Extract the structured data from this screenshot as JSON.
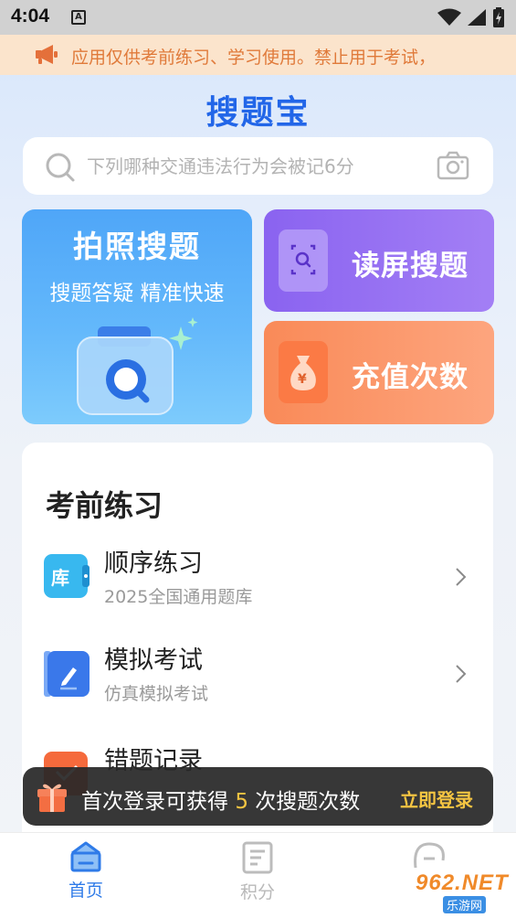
{
  "status_bar": {
    "time": "4:04",
    "a_badge": "A"
  },
  "notice": {
    "text": "应用仅供考前练习、学习使用。禁止用于考试，"
  },
  "app_title": "搜题宝",
  "search": {
    "placeholder": "下列哪种交通违法行为会被记6分"
  },
  "cards": {
    "photo_search": {
      "title": "拍照搜题",
      "subtitle": "搜题答疑 精准快速"
    },
    "screen_search": {
      "label": "读屏搜题"
    },
    "recharge": {
      "label": "充值次数",
      "icon_text": "¥"
    }
  },
  "practice": {
    "title": "考前练习",
    "items": [
      {
        "title": "顺序练习",
        "subtitle": "2025全国通用题库",
        "icon_text": "库"
      },
      {
        "title": "模拟考试",
        "subtitle": "仿真模拟考试"
      },
      {
        "title": "错题记录",
        "subtitle": ""
      }
    ]
  },
  "login_toast": {
    "text_before": "首次登录可获得 ",
    "count": "5",
    "text_after": " 次搜题次数",
    "button": "立即登录"
  },
  "bottom_nav": {
    "items": [
      {
        "label": "首页",
        "active": true
      },
      {
        "label": "积分",
        "active": false
      }
    ]
  },
  "watermark": {
    "text": "962.NET",
    "sub": "乐游网"
  },
  "colors": {
    "brand_blue": "#2266e8",
    "notice_orange": "#e07a3a",
    "purple": "#8a63f0",
    "orange": "#f98a58",
    "toast_highlight": "#f5c542"
  }
}
